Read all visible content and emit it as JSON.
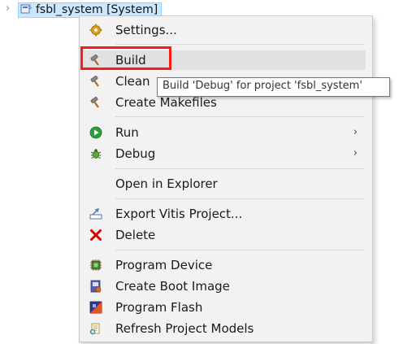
{
  "tree": {
    "project_label": "fsbl_system [System]",
    "expand_icon": "chevron-right-icon",
    "project_icon": "system-project-icon"
  },
  "menu": {
    "items": [
      {
        "label": "Settings...",
        "icon": "gear-icon"
      },
      {
        "label": "Build",
        "icon": "hammer-icon"
      },
      {
        "label": "Clean",
        "icon": "hammer-icon"
      },
      {
        "label": "Create Makefiles",
        "icon": "hammer-icon"
      },
      {
        "label": "Run",
        "icon": "run-icon",
        "submenu": "›"
      },
      {
        "label": "Debug",
        "icon": "bug-icon",
        "submenu": "›"
      },
      {
        "label": "Open in Explorer",
        "icon": ""
      },
      {
        "label": "Export Vitis Project...",
        "icon": "export-icon"
      },
      {
        "label": "Delete",
        "icon": "delete-icon"
      },
      {
        "label": "Program Device",
        "icon": "program-device-icon"
      },
      {
        "label": "Create Boot Image",
        "icon": "boot-image-icon"
      },
      {
        "label": "Program Flash",
        "icon": "flash-icon"
      },
      {
        "label": "Refresh Project Models",
        "icon": "refresh-models-icon"
      }
    ]
  },
  "tooltip": {
    "text": "Build 'Debug' for project 'fsbl_system'"
  },
  "colors": {
    "selection": "#cce8ff",
    "highlight_box": "#ff1a1a",
    "menu_bg": "#f2f2f2",
    "run_green": "#2e9d3e",
    "delete_red": "#d40000"
  }
}
